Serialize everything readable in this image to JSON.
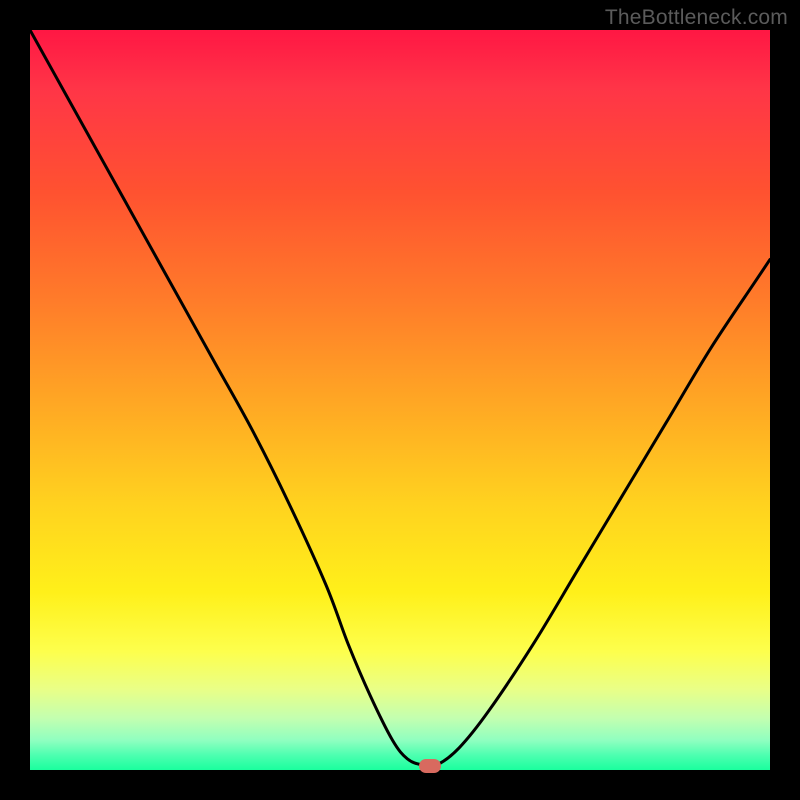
{
  "watermark": {
    "text": "TheBottleneck.com"
  },
  "colors": {
    "background": "#000000",
    "curve_stroke": "#000000",
    "marker_fill": "#d86a5f"
  },
  "chart_data": {
    "type": "line",
    "title": "",
    "xlabel": "",
    "ylabel": "",
    "xlim": [
      0,
      100
    ],
    "ylim": [
      0,
      100
    ],
    "x": [
      0,
      5,
      10,
      15,
      20,
      25,
      30,
      35,
      40,
      43,
      46,
      49,
      51,
      53,
      55,
      58,
      62,
      68,
      74,
      80,
      86,
      92,
      98,
      100
    ],
    "values": [
      100,
      91,
      82,
      73,
      64,
      55,
      46,
      36,
      25,
      17,
      10,
      4,
      1.5,
      0.7,
      0.7,
      3,
      8,
      17,
      27,
      37,
      47,
      57,
      66,
      69
    ],
    "annotations": [
      {
        "name": "marker-point",
        "x": 54,
        "y": 0.6
      }
    ]
  }
}
